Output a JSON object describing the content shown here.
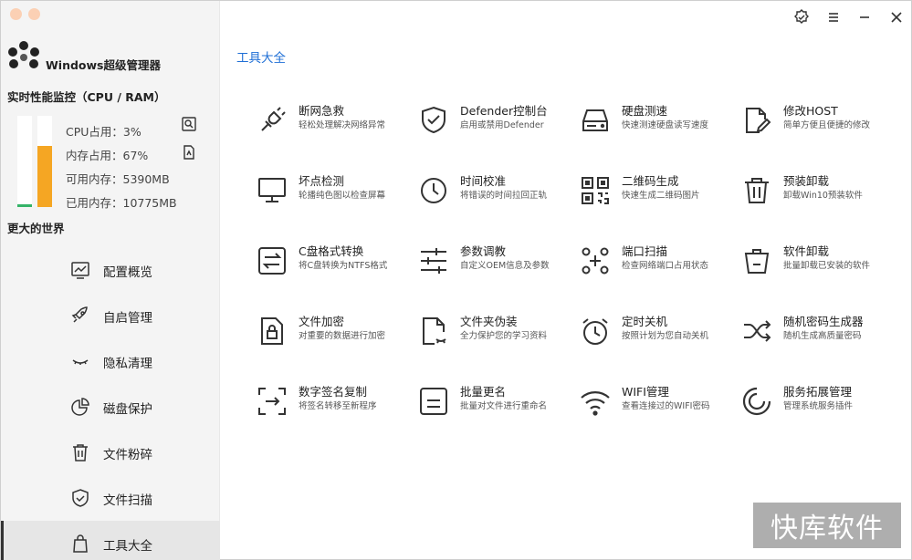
{
  "app": {
    "title": "Windows超级管理器"
  },
  "monitor": {
    "title": "实时性能监控（CPU / RAM）",
    "cpu_percent": 3,
    "mem_percent": 67,
    "cpu_label": "CPU占用：3%",
    "mem_label": "内存占用：67%",
    "free_label": "可用内存：5390MB",
    "used_label": "已用内存：10775MB",
    "colors": {
      "cpu": "#35b368",
      "mem": "#f5a623"
    }
  },
  "slogan": "更大的世界",
  "nav": [
    {
      "label": "配置概览",
      "icon": "chart-monitor-icon"
    },
    {
      "label": "自启管理",
      "icon": "rocket-icon"
    },
    {
      "label": "隐私清理",
      "icon": "eye-closed-icon"
    },
    {
      "label": "磁盘保护",
      "icon": "pie-chart-icon"
    },
    {
      "label": "文件粉碎",
      "icon": "trash-icon"
    },
    {
      "label": "文件扫描",
      "icon": "shield-check-icon"
    },
    {
      "label": "工具大全",
      "icon": "bag-icon",
      "active": true
    }
  ],
  "section": {
    "title": "工具大全"
  },
  "tools": [
    {
      "name": "断网急救",
      "desc": "轻松处理解决网络异常",
      "icon": "plug-icon"
    },
    {
      "name": "Defender控制台",
      "desc": "启用或禁用Defender",
      "icon": "shield-icon"
    },
    {
      "name": "硬盘测速",
      "desc": "快速测速硬盘读写速度",
      "icon": "hard-drive-icon"
    },
    {
      "name": "修改HOST",
      "desc": "简单方便且便捷的修改",
      "icon": "edit-file-icon"
    },
    {
      "name": "坏点检测",
      "desc": "轮播纯色图以检查屏幕",
      "icon": "monitor-icon"
    },
    {
      "name": "时间校准",
      "desc": "将错误的时间拉回正轨",
      "icon": "clock-icon"
    },
    {
      "name": "二维码生成",
      "desc": "快速生成二维码图片",
      "icon": "qrcode-icon"
    },
    {
      "name": "预装卸载",
      "desc": "卸载Win10预装软件",
      "icon": "trash-icon"
    },
    {
      "name": "C盘格式转换",
      "desc": "将C盘转换为NTFS格式",
      "icon": "convert-icon"
    },
    {
      "name": "参数调教",
      "desc": "自定义OEM信息及参数",
      "icon": "sliders-icon"
    },
    {
      "name": "端口扫描",
      "desc": "检查网络端口占用状态",
      "icon": "port-scan-icon"
    },
    {
      "name": "软件卸载",
      "desc": "批量卸载已安装的软件",
      "icon": "trash-bin-icon"
    },
    {
      "name": "文件加密",
      "desc": "对重要的数据进行加密",
      "icon": "file-lock-icon"
    },
    {
      "name": "文件夹伪装",
      "desc": "全力保护您的学习资料",
      "icon": "file-disguise-icon"
    },
    {
      "name": "定时关机",
      "desc": "按照计划为您自动关机",
      "icon": "alarm-clock-icon"
    },
    {
      "name": "随机密码生成器",
      "desc": "随机生成高质量密码",
      "icon": "shuffle-icon"
    },
    {
      "name": "数字签名复制",
      "desc": "将签名转移至新程序",
      "icon": "signature-transfer-icon"
    },
    {
      "name": "批量更名",
      "desc": "批量对文件进行重命名",
      "icon": "rename-icon"
    },
    {
      "name": "WIFI管理",
      "desc": "查看连接过的WIFI密码",
      "icon": "wifi-icon"
    },
    {
      "name": "服务拓展管理",
      "desc": "管理系统服务插件",
      "icon": "service-ring-icon"
    }
  ],
  "watermark": "快库软件"
}
